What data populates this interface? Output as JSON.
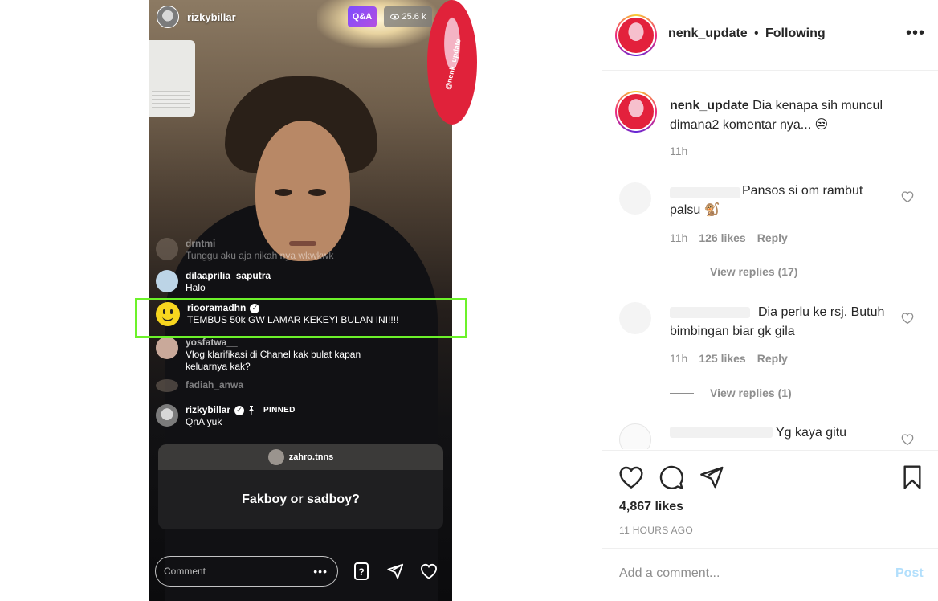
{
  "live": {
    "username": "rizkybillar",
    "qa_badge": "Q&A",
    "viewers": "25.6 k",
    "close_glyph": "✕",
    "sticker_text": "@nenk_update",
    "comments": [
      {
        "user": "drntmi",
        "text": "Tunggu aku aja nikah nya wkwkwk"
      },
      {
        "user": "dilaaprilia_saputra",
        "text": "Halo"
      },
      {
        "user": "riooramadhn",
        "text": "TEMBUS 50k GW LAMAR KEKEYI BULAN INI!!!!"
      },
      {
        "user": "yosfatwa__",
        "text": "Vlog klarifikasi di Chanel kak bulat kapan keluarnya kak?"
      },
      {
        "user": "fadiah_anwa",
        "text": ""
      },
      {
        "user": "rizkybillar",
        "text": "QnA yuk",
        "pinned_label": "PINNED"
      }
    ],
    "question_card": {
      "asker": "zahro.tnns",
      "question": "Fakboy or sadboy?"
    },
    "comment_placeholder": "Comment",
    "comment_more": "•••"
  },
  "post": {
    "author": "nenk_update",
    "follow_label": "Following",
    "separator": "•",
    "more": "•••",
    "caption": {
      "user": "nenk_update",
      "text": "Dia kenapa sih muncul dimana2 komentar nya... 😒",
      "time": "11h"
    },
    "comments": [
      {
        "text": "Pansos si om rambut palsu 🐒",
        "time": "11h",
        "likes": "126 likes",
        "reply": "Reply",
        "view_replies": "View replies (17)"
      },
      {
        "text": "Dia perlu ke rsj. Butuh bimbingan biar gk gila",
        "time": "11h",
        "likes": "125 likes",
        "reply": "Reply",
        "view_replies": "View replies (1)"
      },
      {
        "text": "Yg kaya gitu"
      }
    ],
    "likes": "4,867 likes",
    "time_ago": "11 HOURS AGO",
    "add_comment_placeholder": "Add a comment...",
    "post_button": "Post"
  },
  "colors": {
    "highlight": "#6cf22a",
    "qa_badge": "#8a4cf0",
    "post_button": "#b2dffc",
    "muted_text": "#8e8e8e"
  }
}
